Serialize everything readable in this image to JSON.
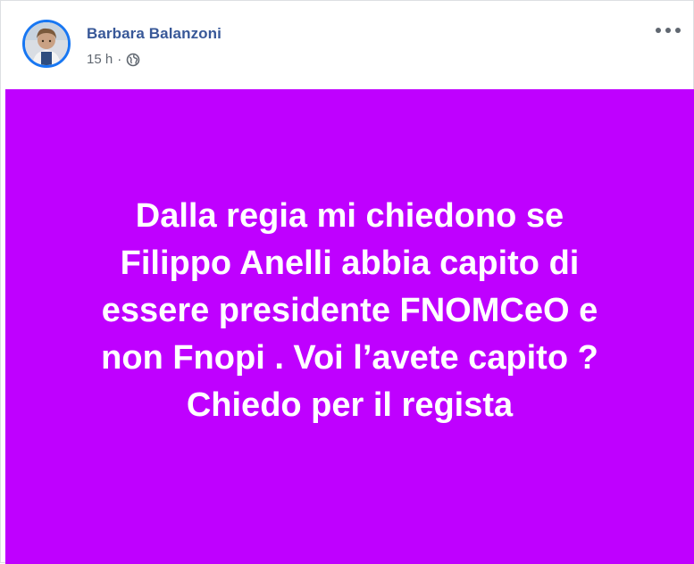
{
  "post": {
    "author": "Barbara Balanzoni",
    "time": "15 h",
    "separator": "·",
    "privacy_icon": "globe-icon",
    "menu_icon": "more-options-icon",
    "avatar_icon": "profile-photo",
    "text": "Dalla regia mi chiedono se\nFilippo Anelli abbia capito di\nessere presidente FNOMCeO e\nnon Fnopi . Voi l’avete capito ?\nChiedo per il regista",
    "background_color": "#bf00ff",
    "text_color": "#ffffff",
    "author_color": "#385898",
    "avatar_ring_color": "#1877f2"
  }
}
